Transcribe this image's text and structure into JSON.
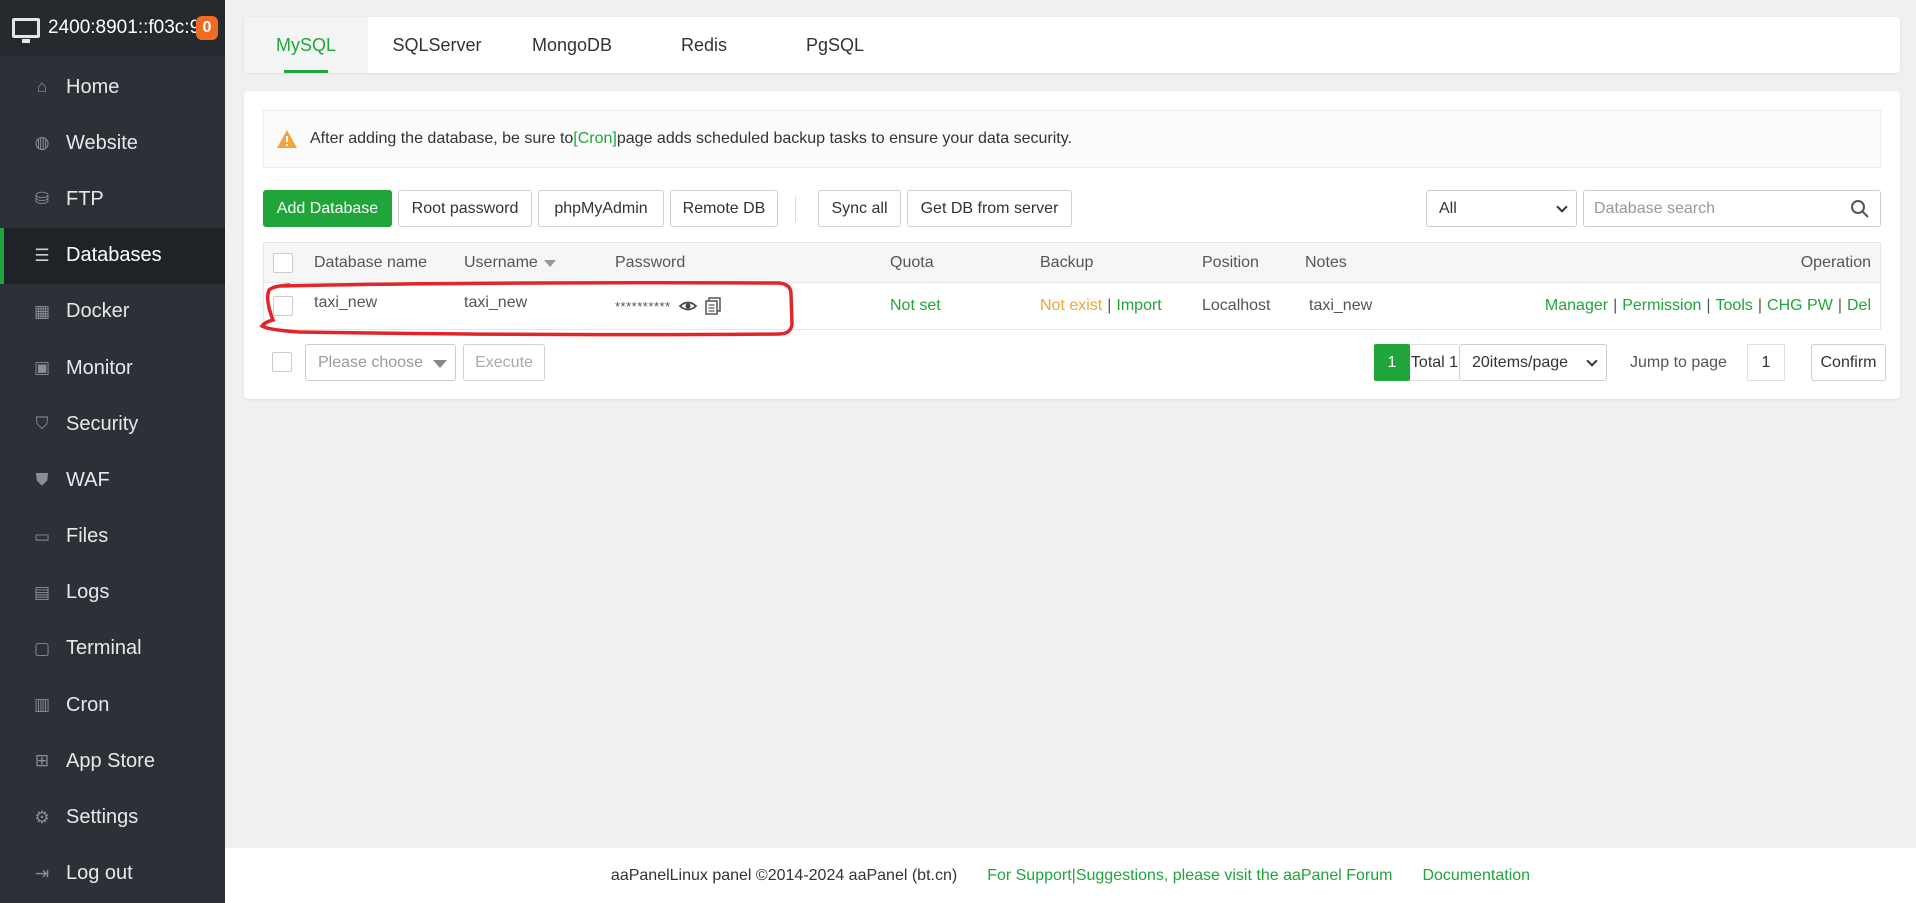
{
  "server": {
    "ip": "2400:8901::f03c:9",
    "badge": "0"
  },
  "sidebar": {
    "items": [
      {
        "label": "Home",
        "icon": "home-icon"
      },
      {
        "label": "Website",
        "icon": "globe-icon"
      },
      {
        "label": "FTP",
        "icon": "ftp-icon"
      },
      {
        "label": "Databases",
        "icon": "database-icon"
      },
      {
        "label": "Docker",
        "icon": "docker-icon"
      },
      {
        "label": "Monitor",
        "icon": "monitor-icon"
      },
      {
        "label": "Security",
        "icon": "shield-icon"
      },
      {
        "label": "WAF",
        "icon": "waf-shield-icon"
      },
      {
        "label": "Files",
        "icon": "folder-icon"
      },
      {
        "label": "Logs",
        "icon": "logs-icon"
      },
      {
        "label": "Terminal",
        "icon": "terminal-icon"
      },
      {
        "label": "Cron",
        "icon": "calendar-icon"
      },
      {
        "label": "App Store",
        "icon": "grid-icon"
      },
      {
        "label": "Settings",
        "icon": "gear-icon"
      },
      {
        "label": "Log out",
        "icon": "logout-icon"
      }
    ],
    "active": "Databases"
  },
  "tabs": [
    "MySQL",
    "SQLServer",
    "MongoDB",
    "Redis",
    "PgSQL"
  ],
  "alert": {
    "before": "After adding the database, be sure to ",
    "link": "[Cron]",
    "after": " page adds scheduled backup tasks to ensure your data security."
  },
  "toolbar": {
    "add_database": "Add Database",
    "root_password": "Root password",
    "phpmyadmin": "phpMyAdmin",
    "remote_db": "Remote DB",
    "sync_all": "Sync all",
    "get_db": "Get DB from server",
    "filter_value": "All",
    "search_placeholder": "Database search"
  },
  "table": {
    "headers": {
      "name": "Database name",
      "username": "Username",
      "password": "Password",
      "quota": "Quota",
      "backup": "Backup",
      "position": "Position",
      "notes": "Notes",
      "operation": "Operation"
    },
    "rows": [
      {
        "name": "taxi_new",
        "username": "taxi_new",
        "password": "**********",
        "quota": "Not set",
        "backup_status": "Not exist",
        "backup_import": "Import",
        "position": "Localhost",
        "notes": "taxi_new",
        "ops": [
          "Manager",
          "Permission",
          "Tools",
          "CHG PW",
          "Del"
        ]
      }
    ]
  },
  "bottom": {
    "batch_placeholder": "Please choose",
    "execute": "Execute",
    "page": "1",
    "total": "Total 1",
    "per_page": "20items/page",
    "jump_label": "Jump to page",
    "jump_value": "1",
    "confirm": "Confirm"
  },
  "footer": {
    "copyright": "aaPanelLinux panel ©2014-2024 aaPanel (bt.cn)",
    "support": "For Support|Suggestions, please visit the aaPanel Forum",
    "docs": "Documentation"
  },
  "colors": {
    "accent": "#20a53a",
    "sidebar": "#2c3138",
    "warning": "#f0a53a",
    "annotation": "#e0262a"
  }
}
